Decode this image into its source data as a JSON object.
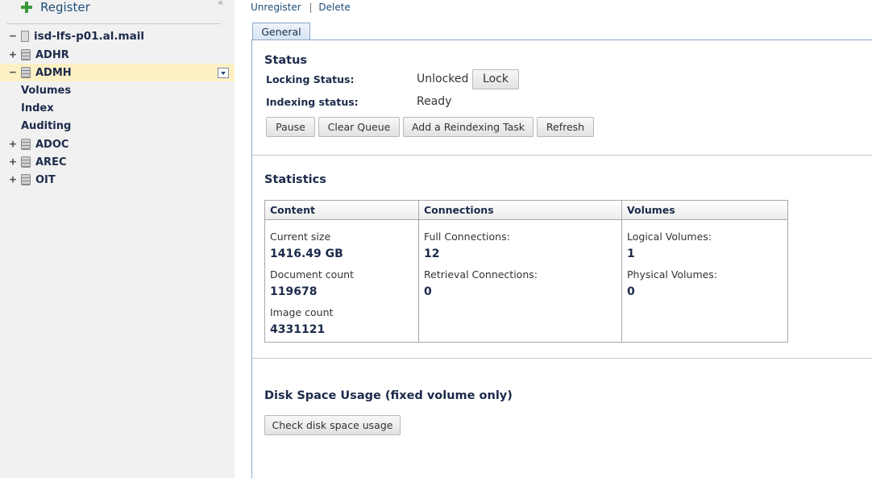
{
  "sidebar": {
    "register_label": "Register",
    "collapse_glyph": "«",
    "tree": {
      "root": {
        "label": "isd-lfs-p01.al.mail",
        "toggle": "−"
      },
      "items": [
        {
          "label": "ADHR",
          "toggle": "+"
        },
        {
          "label": "ADMH",
          "toggle": "−",
          "selected": true
        },
        {
          "label": "ADOC",
          "toggle": "+"
        },
        {
          "label": "AREC",
          "toggle": "+"
        },
        {
          "label": "OIT",
          "toggle": "+"
        }
      ],
      "admh_children": [
        "Volumes",
        "Index",
        "Auditing"
      ]
    }
  },
  "topbar": {
    "unregister": "Unregister",
    "separator": "|",
    "delete": "Delete"
  },
  "tabs": [
    {
      "label": "General",
      "active": true
    }
  ],
  "status": {
    "title": "Status",
    "locking_label": "Locking Status:",
    "locking_value": "Unlocked",
    "lock_button": "Lock",
    "indexing_label": "Indexing status:",
    "indexing_value": "Ready",
    "buttons": {
      "pause": "Pause",
      "clear_queue": "Clear Queue",
      "add_reindex": "Add a Reindexing Task",
      "refresh": "Refresh"
    }
  },
  "statistics": {
    "title": "Statistics",
    "columns": [
      {
        "header": "Content",
        "rows": [
          {
            "label": "Current size",
            "value": "1416.49 GB"
          },
          {
            "label": "Document count",
            "value": "119678"
          },
          {
            "label": "Image count",
            "value": "4331121"
          }
        ]
      },
      {
        "header": "Connections",
        "rows": [
          {
            "label": "Full Connections:",
            "value": "12"
          },
          {
            "label": "Retrieval Connections:",
            "value": "0"
          }
        ]
      },
      {
        "header": "Volumes",
        "rows": [
          {
            "label": "Logical Volumes:",
            "value": "1"
          },
          {
            "label": "Physical Volumes:",
            "value": "0"
          }
        ]
      }
    ]
  },
  "disk": {
    "title": "Disk Space Usage (fixed volume only)",
    "button": "Check disk space usage"
  },
  "colors": {
    "link": "#1f4e79",
    "heading": "#1c2b4a",
    "selected_row": "#fdf0c4",
    "sidebar_bg": "#f1f1f1",
    "tab_border": "#8ca7c9",
    "add_icon": "#3a9a3a"
  },
  "icons": [
    "add-icon",
    "collapse-icon",
    "server-icon",
    "database-icon",
    "dropdown-icon"
  ]
}
